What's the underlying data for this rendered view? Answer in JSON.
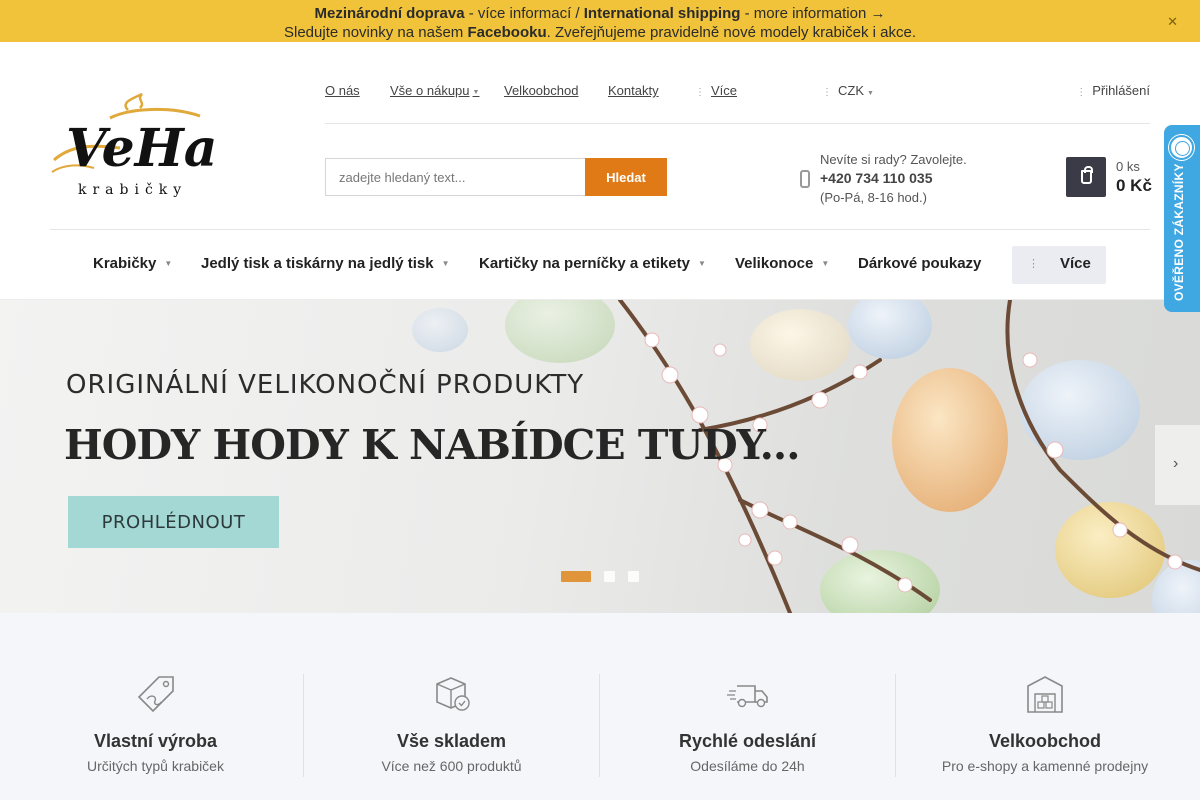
{
  "topbar": {
    "line1_bold1": "Mezinárodní doprava",
    "line1_text1": " - více informací / ",
    "line1_bold2": "International shipping",
    "line1_text2": " - more information →",
    "line2_text1": "Sledujte novinky na našem ",
    "line2_bold": "Facebooku",
    "line2_text2": ". Zveřejňujeme pravidelně nové modely krabiček i akce.",
    "close_icon": "✕"
  },
  "logo": {
    "main": "VeHa",
    "sub": "krabičky"
  },
  "toplinks": {
    "about": "O nás",
    "shopping": "Vše o nákupu",
    "wholesale": "Velkoobchod",
    "contacts": "Kontakty",
    "more": "Více"
  },
  "currency": "CZK",
  "login": "Přihlášení",
  "search": {
    "placeholder": "zadejte hledaný text...",
    "button": "Hledat"
  },
  "contact": {
    "line1": "Nevíte si rady? Zavolejte.",
    "phone": "+420 734 110 035",
    "hours": "(Po-Pá, 8-16 hod.)"
  },
  "cart": {
    "qty": "0 ks",
    "price": "0 Kč"
  },
  "menu": {
    "items": [
      {
        "label": "Krabičky"
      },
      {
        "label": "Jedlý tisk a tiskárny na jedlý tisk"
      },
      {
        "label": "Kartičky na perníčky a etikety"
      },
      {
        "label": "Velikonoce"
      },
      {
        "label": "Dárkové poukazy"
      }
    ],
    "more": "Více"
  },
  "hero": {
    "subtitle": "ORIGINÁLNÍ VELIKONOČNÍ PRODUKTY",
    "title": "HODY HODY K NABÍDCE TUDY...",
    "button": "PROHLÉDNOUT",
    "slide_count": 3,
    "active_slide": 1
  },
  "trust_badge": "OVĚŘENO ZÁKAZNÍKY",
  "features": [
    {
      "title": "Vlastní výroba",
      "subtitle": "Určitých typů krabiček",
      "icon": "tag-icon"
    },
    {
      "title": "Vše skladem",
      "subtitle": "Více než 600 produktů",
      "icon": "box-check-icon"
    },
    {
      "title": "Rychlé odeslání",
      "subtitle": "Odesíláme do 24h",
      "icon": "truck-icon"
    },
    {
      "title": "Velkoobchod",
      "subtitle": "Pro e-shopy a kamenné prodejny",
      "icon": "warehouse-icon"
    }
  ],
  "colors": {
    "banner": "#f1c33a",
    "accent": "#e07a17",
    "hero_button": "#a4d8d4",
    "trust": "#3fa7e1"
  }
}
